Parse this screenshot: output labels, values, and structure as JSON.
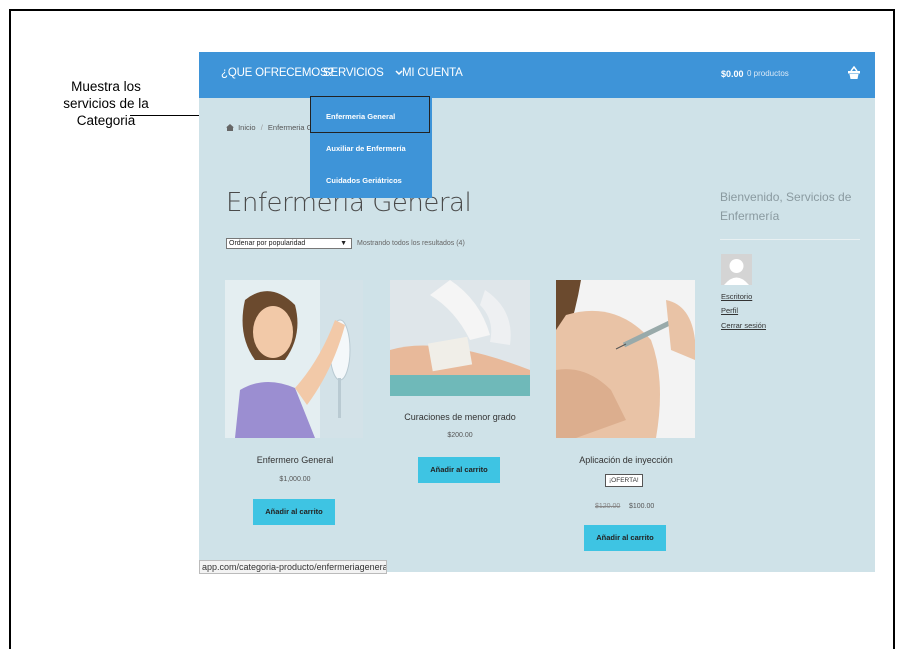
{
  "annotation": {
    "line1": "Muestra los",
    "line2": "servicios de la",
    "line3": "Categoria"
  },
  "nav": {
    "item1": "¿QUE OFRECEMOS?",
    "item2": "SERVICIOS",
    "item3": "MI CUENTA",
    "cart_amount": "$0.00",
    "cart_count": "0 productos",
    "cart_icon": "basket-icon"
  },
  "dropdown": {
    "items": [
      "Enfermeria General",
      "Auxiliar de Enfermería",
      "Cuidados Geriátricos"
    ]
  },
  "breadcrumb": {
    "home": "Inicio",
    "current": "Enfermeria G"
  },
  "page_title": "Enfermeria General",
  "sort": {
    "selected": "Ordenar por popularidad",
    "results": "Mostrando todos los resultados (4)"
  },
  "products": [
    {
      "name": "Enfermero General",
      "price": "$1,000.00",
      "button": "Añadir al carrito"
    },
    {
      "name": "Curaciones de menor grado",
      "price": "$200.00",
      "button": "Añadir al carrito"
    },
    {
      "name": "Aplicación de inyección",
      "badge": "¡OFERTA!",
      "old_price": "$120.00",
      "price": "$100.00",
      "button": "Añadir al carrito"
    }
  ],
  "sidebar": {
    "welcome": "Bienvenido, Servicios de Enfermería",
    "links": [
      "Escritorio",
      "Perfil",
      "Cerrar sesión"
    ]
  },
  "status_url": "app.com/categoria-producto/enfermeriageneral",
  "colors": {
    "nav_bg": "#3e94d8",
    "page_bg": "#cfe2e8",
    "button": "#3ec4e3"
  }
}
